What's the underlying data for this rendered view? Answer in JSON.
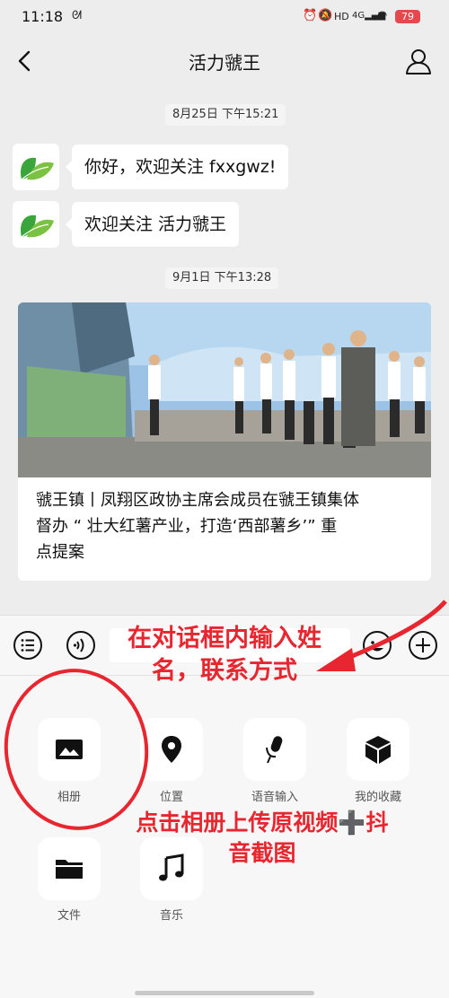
{
  "status_bar": {
    "time": "11:18",
    "battery": "79"
  },
  "header": {
    "title": "活力虢王"
  },
  "chat": {
    "timestamps": [
      "8月25日 下午15:21",
      "9月1日 下午13:28"
    ],
    "messages": [
      "你好，欢迎关注 fxxgwz!",
      "欢迎关注 活力虢王"
    ],
    "article": {
      "title_lines": [
        "虢王镇丨凤翔区政协主席会成员在虢王镇集体",
        "督办 “ 壮大红薯产业，打造‘西部薯乡’” 重",
        "点提案"
      ]
    }
  },
  "toolbar": {
    "icons": [
      "menu-icon",
      "voice-icon",
      "emoji-icon",
      "plus-icon"
    ]
  },
  "panel": {
    "items": [
      {
        "label": "相册",
        "icon": "album-icon"
      },
      {
        "label": "位置",
        "icon": "location-icon"
      },
      {
        "label": "语音输入",
        "icon": "microphone-icon"
      },
      {
        "label": "我的收藏",
        "icon": "favorites-icon"
      },
      {
        "label": "文件",
        "icon": "folder-icon"
      },
      {
        "label": "音乐",
        "icon": "music-icon"
      }
    ]
  },
  "annotations": {
    "input_note_lines": [
      "在对话框内输入姓",
      "名，联系方式"
    ],
    "album_note_lines": [
      "点击相册上传原视频➕抖",
      "音截图"
    ],
    "color": "#e8262f"
  }
}
